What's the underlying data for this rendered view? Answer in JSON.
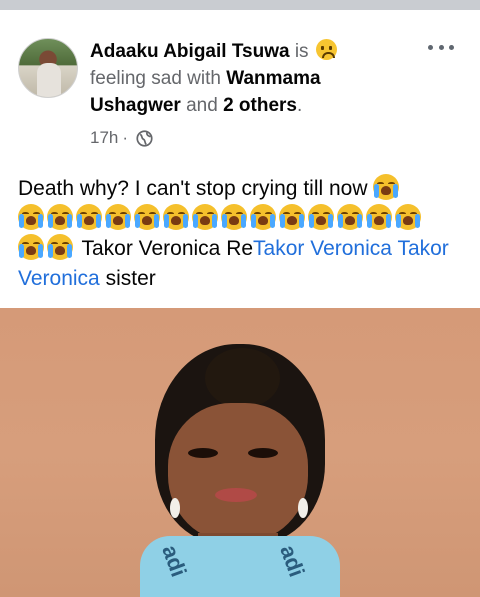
{
  "post": {
    "author": "Adaaku Abigail Tsuwa",
    "is_text": "is",
    "feeling_text": "feeling sad with",
    "tag1": "Wanmama Ushagwer",
    "and_text": "and",
    "others": "2 others",
    "period": ".",
    "time": "17h",
    "dot": "·",
    "body_line1": "Death why? I can't stop crying till now",
    "tail_text": " Takor Veronica Re",
    "link1": "Takor Veronica",
    "link2": "Takor Veronica",
    "tail_end": " sister",
    "icons": {
      "feeling": "sad-face-emoji",
      "crying": "loudly-crying-emoji",
      "privacy": "globe-icon",
      "menu": "more-options-icon"
    }
  }
}
